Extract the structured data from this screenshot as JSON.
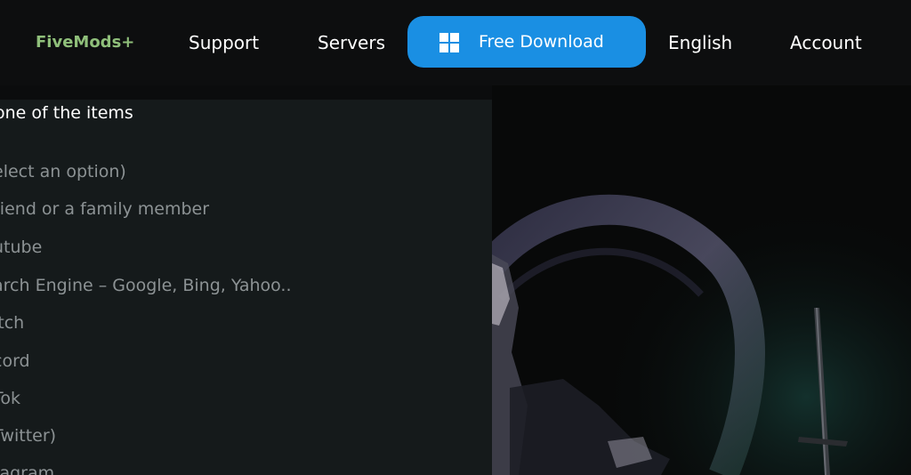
{
  "nav": {
    "brand": "FiveMods+",
    "support": "Support",
    "servers": "Servers",
    "download": "Free Download",
    "language": "English",
    "account": "Account"
  },
  "dropdown": {
    "title": "one of the items",
    "options": [
      "elect an option)",
      "riend or a family member",
      "utube",
      "arch Engine – Google, Bing, Yahoo..",
      "itch",
      "cord",
      "Tok",
      "Twitter)",
      "tagram"
    ]
  },
  "colors": {
    "accent": "#1a8fe3",
    "brand": "#8fbf7a",
    "panel": "#151a1b",
    "option_text": "#8c9294"
  }
}
